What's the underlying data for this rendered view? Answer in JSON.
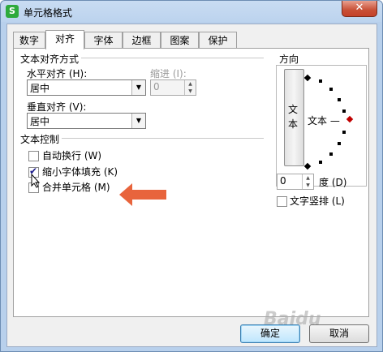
{
  "window": {
    "title": "单元格格式",
    "app_icon_letter": "S",
    "close_glyph": "✕"
  },
  "tabs": [
    {
      "label": "数字"
    },
    {
      "label": "对齐"
    },
    {
      "label": "字体"
    },
    {
      "label": "边框"
    },
    {
      "label": "图案"
    },
    {
      "label": "保护"
    }
  ],
  "active_tab": "对齐",
  "text_alignment": {
    "group_label": "文本对齐方式",
    "horizontal_label": "水平对齐 (H):",
    "horizontal_value": "居中",
    "indent_label": "缩进 (I):",
    "indent_value": "0",
    "vertical_label": "垂直对齐 (V):",
    "vertical_value": "居中"
  },
  "text_control": {
    "group_label": "文本控制",
    "wrap_label": "自动换行 (W)",
    "wrap_checked": false,
    "shrink_label": "缩小字体填充 (K)",
    "shrink_checked": true,
    "merge_label": "合并单元格 (M)",
    "merge_checked": false
  },
  "orientation": {
    "group_label": "方向",
    "vertical_text": "文本",
    "dial_text": "文本 —",
    "degrees_value": "0",
    "degrees_label": "度 (D)",
    "vertical_stack_label": "文字竖排 (L)",
    "vertical_stack_checked": false
  },
  "buttons": {
    "ok": "确定",
    "cancel": "取消"
  },
  "annotation": {
    "arrow_color": "#e8643c"
  },
  "watermark": "Baidu"
}
